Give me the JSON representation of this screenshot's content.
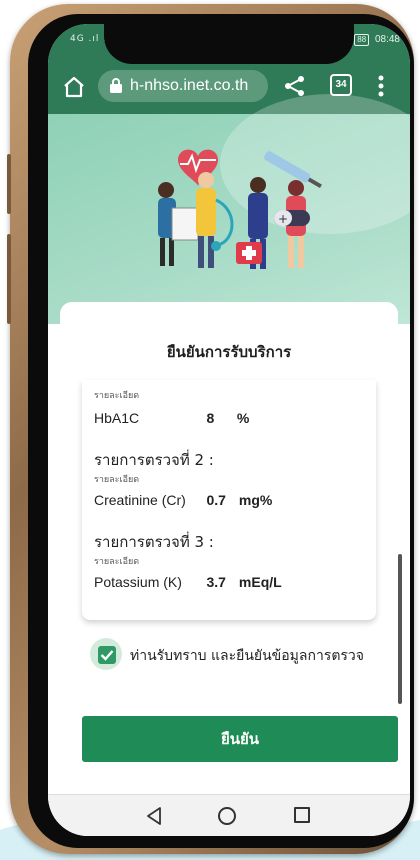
{
  "status": {
    "left": "4G .ıl .ıl",
    "battery": "88",
    "time": "08:48"
  },
  "browser": {
    "url": "h-nhso.inet.co.th",
    "tab_count": "34"
  },
  "card": {
    "title": "ยืนยันการรับบริการ",
    "detail_label": "รายละเอียด",
    "items": [
      {
        "name": "HbA1C",
        "value": "8",
        "unit": "%"
      },
      {
        "heading": "รายการตรวจที่ 2 :",
        "name": "Creatinine (Cr)",
        "value": "0.7",
        "unit": "mg%"
      },
      {
        "heading": "รายการตรวจที่ 3 :",
        "name": "Potassium (K)",
        "value": "3.7",
        "unit": "mEq/L"
      }
    ]
  },
  "consent": {
    "label": "ท่านรับทราบ และยืนยันข้อมูลการตรวจ",
    "checked": true
  },
  "confirm_button": "ยืนยัน",
  "colors": {
    "primary_green": "#1f8b57",
    "header_green": "#2f7a57",
    "hero_mint": "#a9dcc8"
  }
}
